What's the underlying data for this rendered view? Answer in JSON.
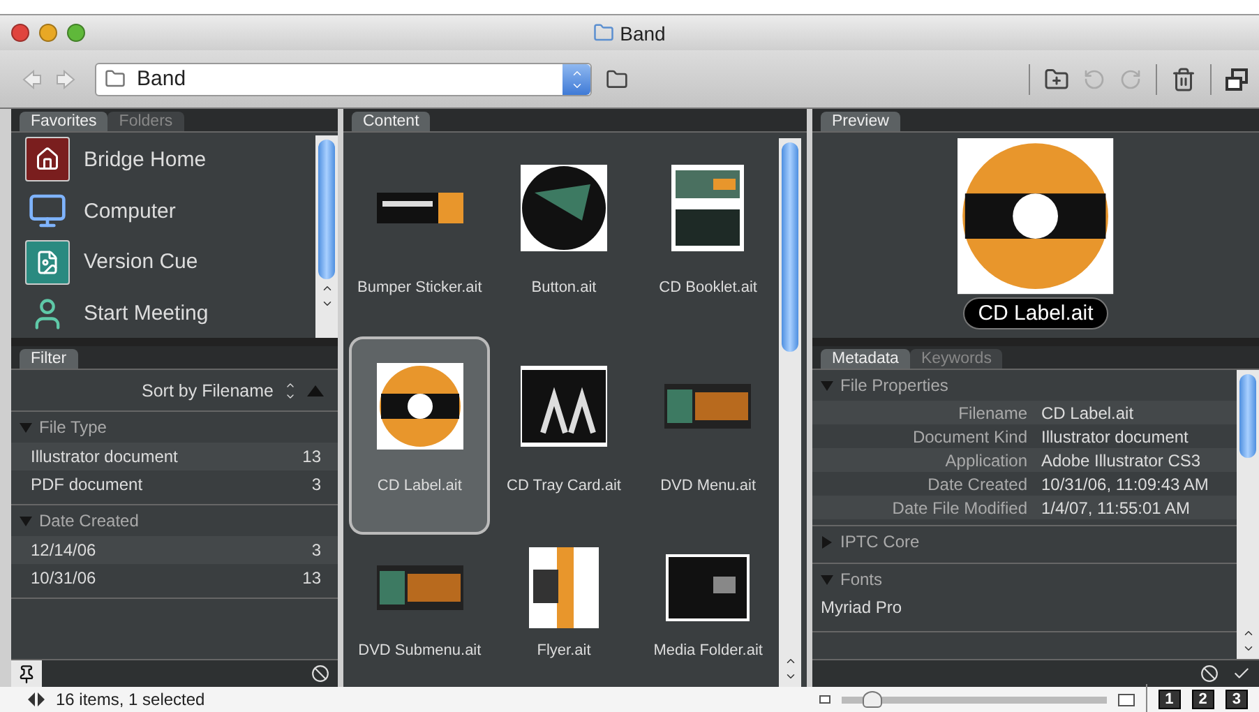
{
  "window": {
    "title": "Band"
  },
  "toolbar": {
    "path": "Band"
  },
  "favorites": {
    "tabs": [
      {
        "label": "Favorites",
        "selected": true
      },
      {
        "label": "Folders",
        "selected": false
      }
    ],
    "items": [
      {
        "label": "Bridge Home",
        "kind": "home"
      },
      {
        "label": "Computer",
        "kind": "computer"
      },
      {
        "label": "Version Cue",
        "kind": "versioncue"
      },
      {
        "label": "Start Meeting",
        "kind": "meeting"
      }
    ]
  },
  "filter": {
    "tab": "Filter",
    "sort": "Sort by Filename",
    "groups": [
      {
        "title": "File Type",
        "expanded": true,
        "items": [
          {
            "label": "Illustrator document",
            "count": "13"
          },
          {
            "label": "PDF document",
            "count": "3"
          }
        ]
      },
      {
        "title": "Date Created",
        "expanded": true,
        "items": [
          {
            "label": "12/14/06",
            "count": "3"
          },
          {
            "label": "10/31/06",
            "count": "13"
          }
        ]
      }
    ]
  },
  "content": {
    "tab": "Content",
    "items": [
      {
        "name": "Bumper Sticker.ait",
        "kind": "sticker",
        "selected": false
      },
      {
        "name": "Button.ait",
        "kind": "button",
        "selected": false
      },
      {
        "name": "CD Booklet.ait",
        "kind": "booklet",
        "selected": false
      },
      {
        "name": "CD Label.ait",
        "kind": "cdlabel",
        "selected": true
      },
      {
        "name": "CD Tray Card.ait",
        "kind": "tray",
        "selected": false
      },
      {
        "name": "DVD Menu.ait",
        "kind": "dvdmenu",
        "selected": false
      },
      {
        "name": "DVD Submenu.ait",
        "kind": "dvdmenu",
        "selected": false
      },
      {
        "name": "Flyer.ait",
        "kind": "flyer",
        "selected": false
      },
      {
        "name": "Media Folder.ait",
        "kind": "folder",
        "selected": false
      }
    ]
  },
  "preview": {
    "tab": "Preview",
    "caption": "CD Label.ait"
  },
  "metadata": {
    "tabs": [
      {
        "label": "Metadata",
        "selected": true
      },
      {
        "label": "Keywords",
        "selected": false
      }
    ],
    "sections": [
      {
        "title": "File Properties",
        "expanded": true,
        "fields": [
          {
            "label": "Filename",
            "value": "CD Label.ait"
          },
          {
            "label": "Document Kind",
            "value": "Illustrator document"
          },
          {
            "label": "Application",
            "value": "Adobe Illustrator CS3"
          },
          {
            "label": "Date Created",
            "value": "10/31/06, 11:09:43 AM"
          },
          {
            "label": "Date File Modified",
            "value": "1/4/07, 11:55:01 AM"
          }
        ]
      },
      {
        "title": "IPTC Core",
        "expanded": false
      },
      {
        "title": "Fonts",
        "expanded": true,
        "lines": [
          "Myriad Pro"
        ]
      }
    ]
  },
  "status": {
    "text": "16 items, 1 selected",
    "zoom": {
      "level": 0.12
    },
    "views": [
      "1",
      "2",
      "3"
    ]
  }
}
